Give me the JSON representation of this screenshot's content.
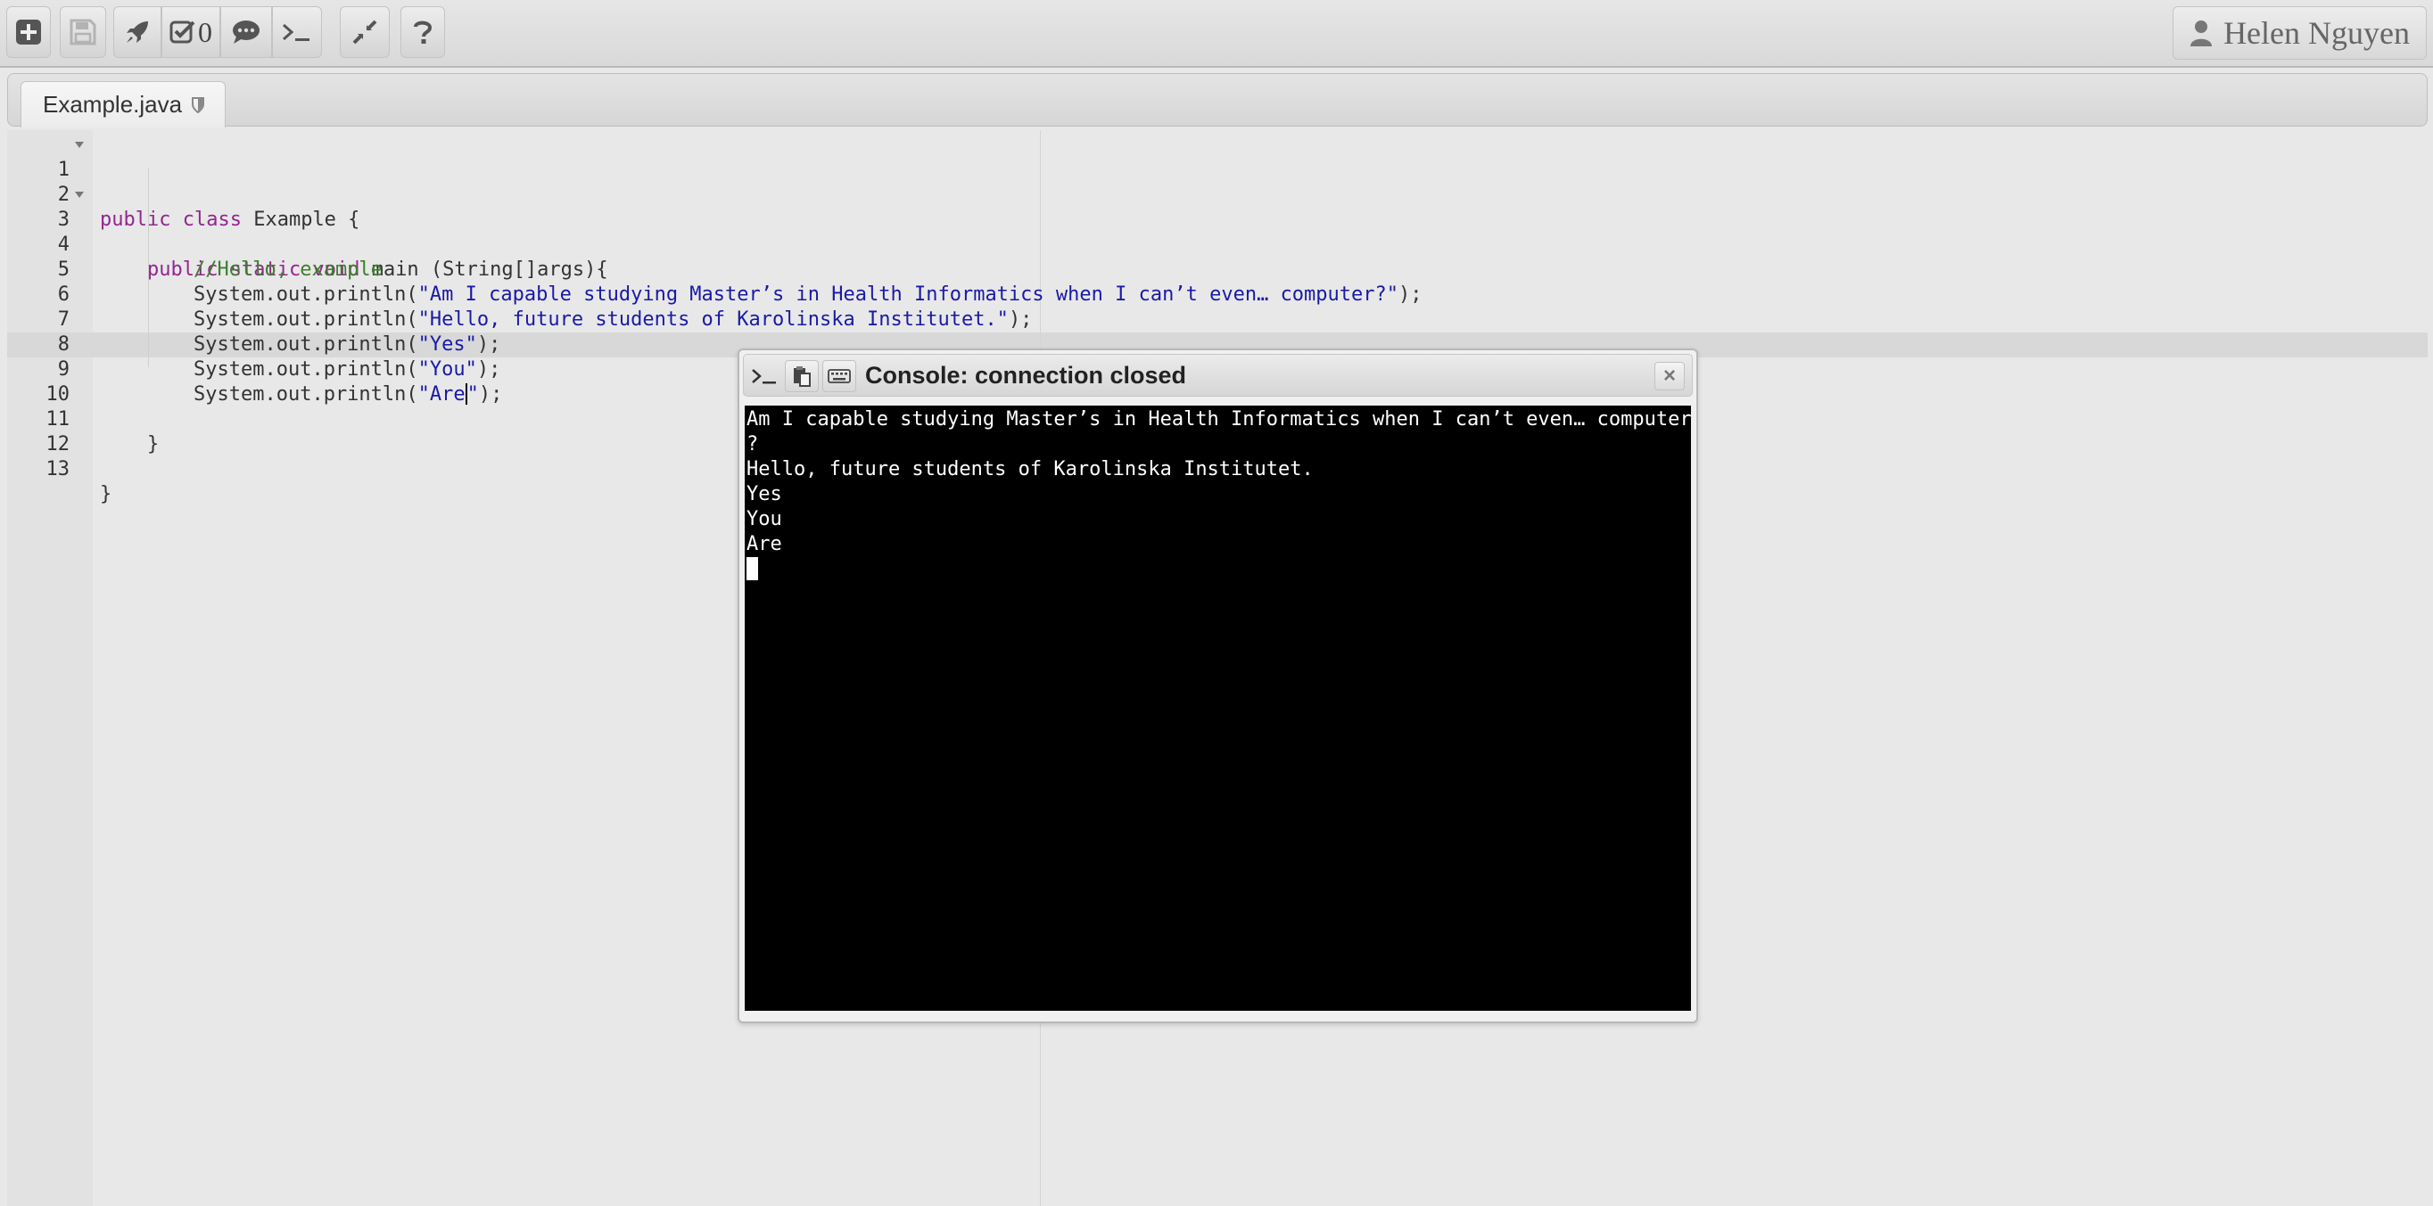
{
  "toolbar": {
    "buttons": [
      {
        "icon": "plus-square-icon",
        "enabled": true
      },
      {
        "icon": "save-icon",
        "enabled": false
      },
      {
        "icon": "rocket-icon",
        "enabled": true
      },
      {
        "icon": "check-icon",
        "enabled": true
      },
      {
        "icon": "comment-icon",
        "enabled": true
      },
      {
        "icon": "terminal-icon",
        "enabled": true
      },
      {
        "icon": "compress-icon",
        "enabled": true
      },
      {
        "icon": "question-icon",
        "enabled": true
      }
    ],
    "check_count": "0",
    "user_name": "Helen Nguyen"
  },
  "tabs": [
    {
      "label": "Example.java",
      "icon": "shield-icon",
      "active": true
    }
  ],
  "editor": {
    "active_line": 9,
    "lines": [
      {
        "n": "1",
        "fold": true
      },
      {
        "n": "2"
      },
      {
        "n": "3",
        "fold": true
      },
      {
        "n": "4"
      },
      {
        "n": "5"
      },
      {
        "n": "6"
      },
      {
        "n": "7"
      },
      {
        "n": "8"
      },
      {
        "n": "9"
      },
      {
        "n": "10"
      },
      {
        "n": "11"
      },
      {
        "n": "12"
      },
      {
        "n": "13"
      }
    ],
    "code": {
      "l1_kw1": "public",
      "l1_kw2": "class",
      "l1_rest": " Example {",
      "l3_kw1": "public",
      "l3_kw2": "static",
      "l3_kw3": "void",
      "l3_rest": " main (String[]args){",
      "l4_comment": "//Hello, example",
      "println_call": "System.out.println(",
      "l5_str": "\"Am I capable studying Master’s in Health Informatics when I can’t even… computer?\"",
      "l6_str": "\"Hello, future students of Karolinska Institutet.\"",
      "l7_str": "\"Yes\"",
      "l8_str": "\"You\"",
      "l9_str_a": "\"Are",
      "l9_str_b": "\"",
      "stmt_end": ");",
      "l11_brace": "}",
      "l13_brace": "}"
    }
  },
  "console": {
    "title": "Console: connection closed",
    "header_icons": [
      "terminal-icon",
      "clipboard-icon",
      "keyboard-icon"
    ],
    "close_label": "×",
    "output": [
      "Am I capable studying Master’s in Health Informatics when I can’t even… computer",
      "?",
      "Hello, future students of Karolinska Institutet.",
      "Yes",
      "You",
      "Are"
    ]
  }
}
